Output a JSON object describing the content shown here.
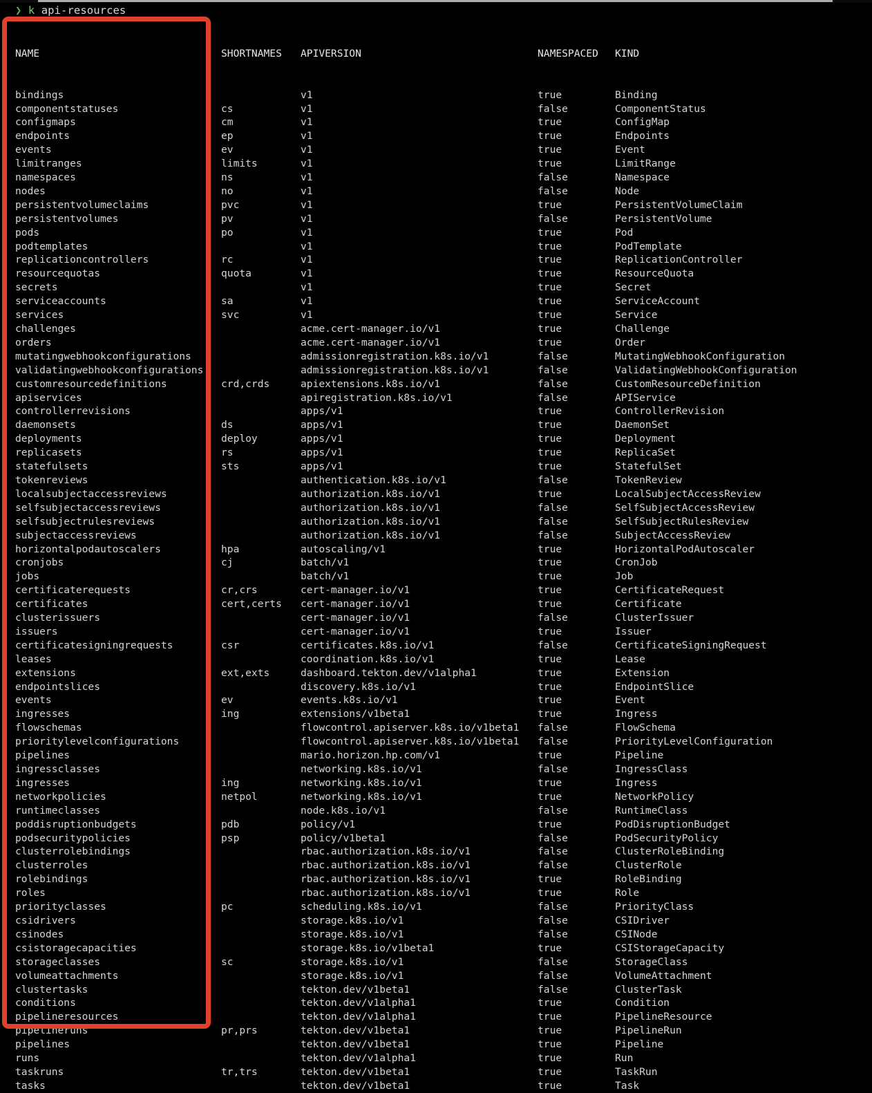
{
  "terminal": {
    "prompt_symbol": "❯",
    "command_name": "k",
    "command_args": "api-resources",
    "highlight_color": "#e0412c",
    "prompt_color": "#4ab84a",
    "text_color": "#d4d4d4",
    "background_color": "#000000"
  },
  "table": {
    "headers": {
      "name": "NAME",
      "shortnames": "SHORTNAMES",
      "apiversion": "APIVERSION",
      "namespaced": "NAMESPACED",
      "kind": "KIND"
    },
    "rows": [
      {
        "name": "bindings",
        "shortnames": "",
        "apiversion": "v1",
        "namespaced": "true",
        "kind": "Binding"
      },
      {
        "name": "componentstatuses",
        "shortnames": "cs",
        "apiversion": "v1",
        "namespaced": "false",
        "kind": "ComponentStatus"
      },
      {
        "name": "configmaps",
        "shortnames": "cm",
        "apiversion": "v1",
        "namespaced": "true",
        "kind": "ConfigMap"
      },
      {
        "name": "endpoints",
        "shortnames": "ep",
        "apiversion": "v1",
        "namespaced": "true",
        "kind": "Endpoints"
      },
      {
        "name": "events",
        "shortnames": "ev",
        "apiversion": "v1",
        "namespaced": "true",
        "kind": "Event"
      },
      {
        "name": "limitranges",
        "shortnames": "limits",
        "apiversion": "v1",
        "namespaced": "true",
        "kind": "LimitRange"
      },
      {
        "name": "namespaces",
        "shortnames": "ns",
        "apiversion": "v1",
        "namespaced": "false",
        "kind": "Namespace"
      },
      {
        "name": "nodes",
        "shortnames": "no",
        "apiversion": "v1",
        "namespaced": "false",
        "kind": "Node"
      },
      {
        "name": "persistentvolumeclaims",
        "shortnames": "pvc",
        "apiversion": "v1",
        "namespaced": "true",
        "kind": "PersistentVolumeClaim"
      },
      {
        "name": "persistentvolumes",
        "shortnames": "pv",
        "apiversion": "v1",
        "namespaced": "false",
        "kind": "PersistentVolume"
      },
      {
        "name": "pods",
        "shortnames": "po",
        "apiversion": "v1",
        "namespaced": "true",
        "kind": "Pod"
      },
      {
        "name": "podtemplates",
        "shortnames": "",
        "apiversion": "v1",
        "namespaced": "true",
        "kind": "PodTemplate"
      },
      {
        "name": "replicationcontrollers",
        "shortnames": "rc",
        "apiversion": "v1",
        "namespaced": "true",
        "kind": "ReplicationController"
      },
      {
        "name": "resourcequotas",
        "shortnames": "quota",
        "apiversion": "v1",
        "namespaced": "true",
        "kind": "ResourceQuota"
      },
      {
        "name": "secrets",
        "shortnames": "",
        "apiversion": "v1",
        "namespaced": "true",
        "kind": "Secret"
      },
      {
        "name": "serviceaccounts",
        "shortnames": "sa",
        "apiversion": "v1",
        "namespaced": "true",
        "kind": "ServiceAccount"
      },
      {
        "name": "services",
        "shortnames": "svc",
        "apiversion": "v1",
        "namespaced": "true",
        "kind": "Service"
      },
      {
        "name": "challenges",
        "shortnames": "",
        "apiversion": "acme.cert-manager.io/v1",
        "namespaced": "true",
        "kind": "Challenge"
      },
      {
        "name": "orders",
        "shortnames": "",
        "apiversion": "acme.cert-manager.io/v1",
        "namespaced": "true",
        "kind": "Order"
      },
      {
        "name": "mutatingwebhookconfigurations",
        "shortnames": "",
        "apiversion": "admissionregistration.k8s.io/v1",
        "namespaced": "false",
        "kind": "MutatingWebhookConfiguration"
      },
      {
        "name": "validatingwebhookconfigurations",
        "shortnames": "",
        "apiversion": "admissionregistration.k8s.io/v1",
        "namespaced": "false",
        "kind": "ValidatingWebhookConfiguration"
      },
      {
        "name": "customresourcedefinitions",
        "shortnames": "crd,crds",
        "apiversion": "apiextensions.k8s.io/v1",
        "namespaced": "false",
        "kind": "CustomResourceDefinition"
      },
      {
        "name": "apiservices",
        "shortnames": "",
        "apiversion": "apiregistration.k8s.io/v1",
        "namespaced": "false",
        "kind": "APIService"
      },
      {
        "name": "controllerrevisions",
        "shortnames": "",
        "apiversion": "apps/v1",
        "namespaced": "true",
        "kind": "ControllerRevision"
      },
      {
        "name": "daemonsets",
        "shortnames": "ds",
        "apiversion": "apps/v1",
        "namespaced": "true",
        "kind": "DaemonSet"
      },
      {
        "name": "deployments",
        "shortnames": "deploy",
        "apiversion": "apps/v1",
        "namespaced": "true",
        "kind": "Deployment"
      },
      {
        "name": "replicasets",
        "shortnames": "rs",
        "apiversion": "apps/v1",
        "namespaced": "true",
        "kind": "ReplicaSet"
      },
      {
        "name": "statefulsets",
        "shortnames": "sts",
        "apiversion": "apps/v1",
        "namespaced": "true",
        "kind": "StatefulSet"
      },
      {
        "name": "tokenreviews",
        "shortnames": "",
        "apiversion": "authentication.k8s.io/v1",
        "namespaced": "false",
        "kind": "TokenReview"
      },
      {
        "name": "localsubjectaccessreviews",
        "shortnames": "",
        "apiversion": "authorization.k8s.io/v1",
        "namespaced": "true",
        "kind": "LocalSubjectAccessReview"
      },
      {
        "name": "selfsubjectaccessreviews",
        "shortnames": "",
        "apiversion": "authorization.k8s.io/v1",
        "namespaced": "false",
        "kind": "SelfSubjectAccessReview"
      },
      {
        "name": "selfsubjectrulesreviews",
        "shortnames": "",
        "apiversion": "authorization.k8s.io/v1",
        "namespaced": "false",
        "kind": "SelfSubjectRulesReview"
      },
      {
        "name": "subjectaccessreviews",
        "shortnames": "",
        "apiversion": "authorization.k8s.io/v1",
        "namespaced": "false",
        "kind": "SubjectAccessReview"
      },
      {
        "name": "horizontalpodautoscalers",
        "shortnames": "hpa",
        "apiversion": "autoscaling/v1",
        "namespaced": "true",
        "kind": "HorizontalPodAutoscaler"
      },
      {
        "name": "cronjobs",
        "shortnames": "cj",
        "apiversion": "batch/v1",
        "namespaced": "true",
        "kind": "CronJob"
      },
      {
        "name": "jobs",
        "shortnames": "",
        "apiversion": "batch/v1",
        "namespaced": "true",
        "kind": "Job"
      },
      {
        "name": "certificaterequests",
        "shortnames": "cr,crs",
        "apiversion": "cert-manager.io/v1",
        "namespaced": "true",
        "kind": "CertificateRequest"
      },
      {
        "name": "certificates",
        "shortnames": "cert,certs",
        "apiversion": "cert-manager.io/v1",
        "namespaced": "true",
        "kind": "Certificate"
      },
      {
        "name": "clusterissuers",
        "shortnames": "",
        "apiversion": "cert-manager.io/v1",
        "namespaced": "false",
        "kind": "ClusterIssuer"
      },
      {
        "name": "issuers",
        "shortnames": "",
        "apiversion": "cert-manager.io/v1",
        "namespaced": "true",
        "kind": "Issuer"
      },
      {
        "name": "certificatesigningrequests",
        "shortnames": "csr",
        "apiversion": "certificates.k8s.io/v1",
        "namespaced": "false",
        "kind": "CertificateSigningRequest"
      },
      {
        "name": "leases",
        "shortnames": "",
        "apiversion": "coordination.k8s.io/v1",
        "namespaced": "true",
        "kind": "Lease"
      },
      {
        "name": "extensions",
        "shortnames": "ext,exts",
        "apiversion": "dashboard.tekton.dev/v1alpha1",
        "namespaced": "true",
        "kind": "Extension"
      },
      {
        "name": "endpointslices",
        "shortnames": "",
        "apiversion": "discovery.k8s.io/v1",
        "namespaced": "true",
        "kind": "EndpointSlice"
      },
      {
        "name": "events",
        "shortnames": "ev",
        "apiversion": "events.k8s.io/v1",
        "namespaced": "true",
        "kind": "Event"
      },
      {
        "name": "ingresses",
        "shortnames": "ing",
        "apiversion": "extensions/v1beta1",
        "namespaced": "true",
        "kind": "Ingress"
      },
      {
        "name": "flowschemas",
        "shortnames": "",
        "apiversion": "flowcontrol.apiserver.k8s.io/v1beta1",
        "namespaced": "false",
        "kind": "FlowSchema"
      },
      {
        "name": "prioritylevelconfigurations",
        "shortnames": "",
        "apiversion": "flowcontrol.apiserver.k8s.io/v1beta1",
        "namespaced": "false",
        "kind": "PriorityLevelConfiguration"
      },
      {
        "name": "pipelines",
        "shortnames": "",
        "apiversion": "mario.horizon.hp.com/v1",
        "namespaced": "true",
        "kind": "Pipeline"
      },
      {
        "name": "ingressclasses",
        "shortnames": "",
        "apiversion": "networking.k8s.io/v1",
        "namespaced": "false",
        "kind": "IngressClass"
      },
      {
        "name": "ingresses",
        "shortnames": "ing",
        "apiversion": "networking.k8s.io/v1",
        "namespaced": "true",
        "kind": "Ingress"
      },
      {
        "name": "networkpolicies",
        "shortnames": "netpol",
        "apiversion": "networking.k8s.io/v1",
        "namespaced": "true",
        "kind": "NetworkPolicy"
      },
      {
        "name": "runtimeclasses",
        "shortnames": "",
        "apiversion": "node.k8s.io/v1",
        "namespaced": "false",
        "kind": "RuntimeClass"
      },
      {
        "name": "poddisruptionbudgets",
        "shortnames": "pdb",
        "apiversion": "policy/v1",
        "namespaced": "true",
        "kind": "PodDisruptionBudget"
      },
      {
        "name": "podsecuritypolicies",
        "shortnames": "psp",
        "apiversion": "policy/v1beta1",
        "namespaced": "false",
        "kind": "PodSecurityPolicy"
      },
      {
        "name": "clusterrolebindings",
        "shortnames": "",
        "apiversion": "rbac.authorization.k8s.io/v1",
        "namespaced": "false",
        "kind": "ClusterRoleBinding"
      },
      {
        "name": "clusterroles",
        "shortnames": "",
        "apiversion": "rbac.authorization.k8s.io/v1",
        "namespaced": "false",
        "kind": "ClusterRole"
      },
      {
        "name": "rolebindings",
        "shortnames": "",
        "apiversion": "rbac.authorization.k8s.io/v1",
        "namespaced": "true",
        "kind": "RoleBinding"
      },
      {
        "name": "roles",
        "shortnames": "",
        "apiversion": "rbac.authorization.k8s.io/v1",
        "namespaced": "true",
        "kind": "Role"
      },
      {
        "name": "priorityclasses",
        "shortnames": "pc",
        "apiversion": "scheduling.k8s.io/v1",
        "namespaced": "false",
        "kind": "PriorityClass"
      },
      {
        "name": "csidrivers",
        "shortnames": "",
        "apiversion": "storage.k8s.io/v1",
        "namespaced": "false",
        "kind": "CSIDriver"
      },
      {
        "name": "csinodes",
        "shortnames": "",
        "apiversion": "storage.k8s.io/v1",
        "namespaced": "false",
        "kind": "CSINode"
      },
      {
        "name": "csistoragecapacities",
        "shortnames": "",
        "apiversion": "storage.k8s.io/v1beta1",
        "namespaced": "true",
        "kind": "CSIStorageCapacity"
      },
      {
        "name": "storageclasses",
        "shortnames": "sc",
        "apiversion": "storage.k8s.io/v1",
        "namespaced": "false",
        "kind": "StorageClass"
      },
      {
        "name": "volumeattachments",
        "shortnames": "",
        "apiversion": "storage.k8s.io/v1",
        "namespaced": "false",
        "kind": "VolumeAttachment"
      },
      {
        "name": "clustertasks",
        "shortnames": "",
        "apiversion": "tekton.dev/v1beta1",
        "namespaced": "false",
        "kind": "ClusterTask"
      },
      {
        "name": "conditions",
        "shortnames": "",
        "apiversion": "tekton.dev/v1alpha1",
        "namespaced": "true",
        "kind": "Condition"
      },
      {
        "name": "pipelineresources",
        "shortnames": "",
        "apiversion": "tekton.dev/v1alpha1",
        "namespaced": "true",
        "kind": "PipelineResource"
      },
      {
        "name": "pipelineruns",
        "shortnames": "pr,prs",
        "apiversion": "tekton.dev/v1beta1",
        "namespaced": "true",
        "kind": "PipelineRun"
      },
      {
        "name": "pipelines",
        "shortnames": "",
        "apiversion": "tekton.dev/v1beta1",
        "namespaced": "true",
        "kind": "Pipeline"
      },
      {
        "name": "runs",
        "shortnames": "",
        "apiversion": "tekton.dev/v1alpha1",
        "namespaced": "true",
        "kind": "Run"
      },
      {
        "name": "taskruns",
        "shortnames": "tr,trs",
        "apiversion": "tekton.dev/v1beta1",
        "namespaced": "true",
        "kind": "TaskRun"
      },
      {
        "name": "tasks",
        "shortnames": "",
        "apiversion": "tekton.dev/v1beta1",
        "namespaced": "true",
        "kind": "Task"
      }
    ]
  }
}
